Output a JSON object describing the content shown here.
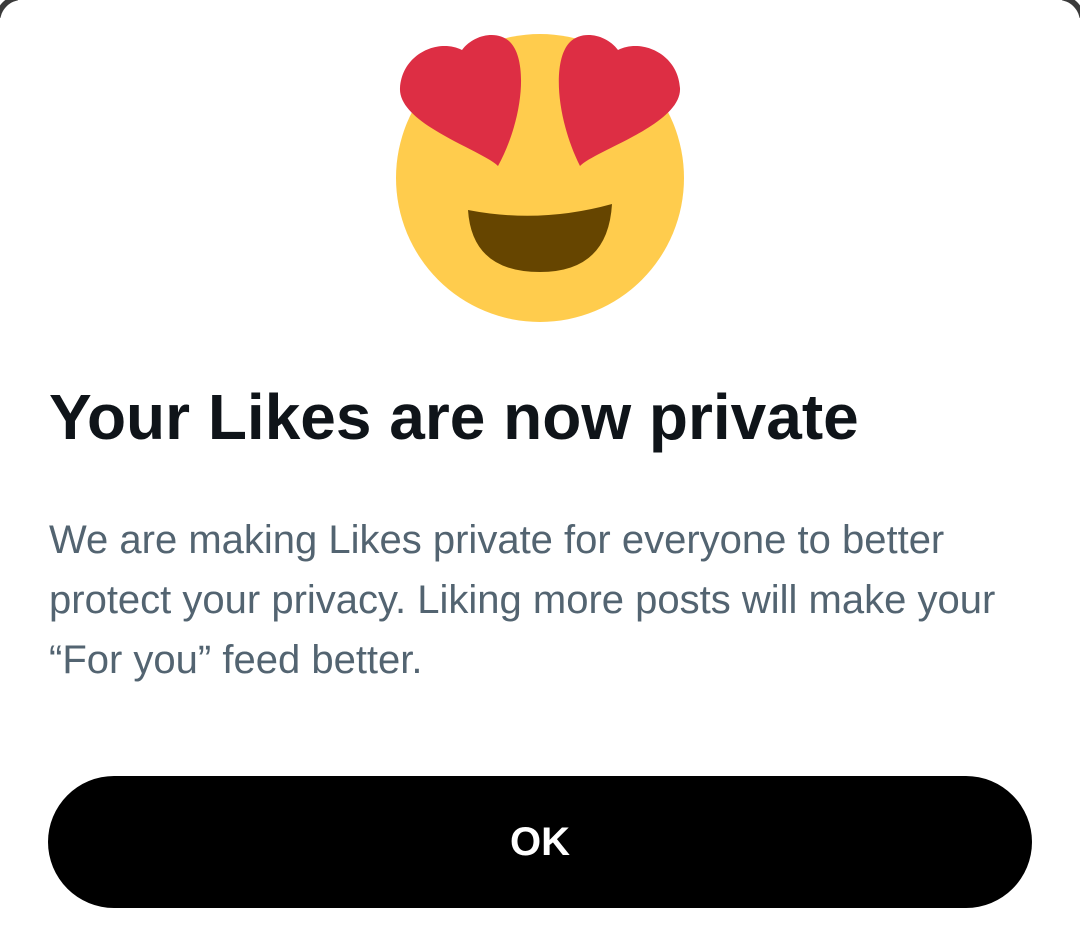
{
  "dialog": {
    "emoji_icon": "smiling-face-with-heart-eyes-icon",
    "title": "Your Likes are now private",
    "body": "We are making Likes private for everyone to better protect your privacy. Liking more posts will make your “For you” feed better.",
    "ok_label": "OK"
  },
  "colors": {
    "title": "#0f1419",
    "body": "#536471",
    "button_bg": "#000000",
    "button_text": "#ffffff",
    "emoji_face": "#FFCC4D",
    "emoji_hearts": "#DD2E44",
    "emoji_mouth": "#664500"
  }
}
